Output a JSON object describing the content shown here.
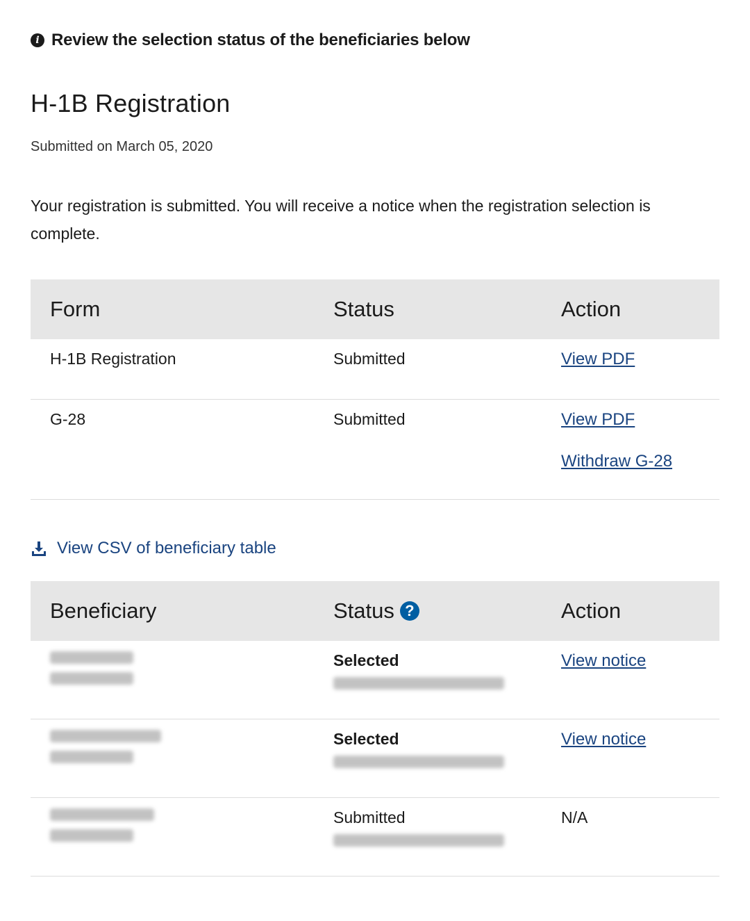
{
  "banner": {
    "text": "Review the selection status of the beneficiaries below",
    "icon": "info-icon"
  },
  "registration": {
    "title": "H-1B Registration",
    "submitted_date": "Submitted on March 05, 2020",
    "notice": "Your registration is submitted. You will receive a notice when the registration selection is complete."
  },
  "forms_table": {
    "headers": [
      "Form",
      "Status",
      "Action"
    ],
    "rows": [
      {
        "form": "H-1B Registration",
        "status": "Submitted",
        "actions": [
          "View PDF"
        ]
      },
      {
        "form": "G-28",
        "status": "Submitted",
        "actions": [
          "View PDF",
          "Withdraw G-28"
        ]
      }
    ]
  },
  "csv_link": {
    "label": "View CSV of beneficiary table",
    "icon": "download-icon"
  },
  "beneficiary_table": {
    "headers": [
      "Beneficiary",
      "Status",
      "Action"
    ],
    "help_icon": "?",
    "rows": [
      {
        "status": "Selected",
        "action": "View notice",
        "status_bold": true
      },
      {
        "status": "Selected",
        "action": "View notice",
        "status_bold": true
      },
      {
        "status": "Submitted",
        "action": "N/A",
        "status_bold": false
      }
    ]
  },
  "colors": {
    "link": "#1a4480",
    "help_icon": "#005ea2",
    "header_bg": "#e6e6e6"
  }
}
